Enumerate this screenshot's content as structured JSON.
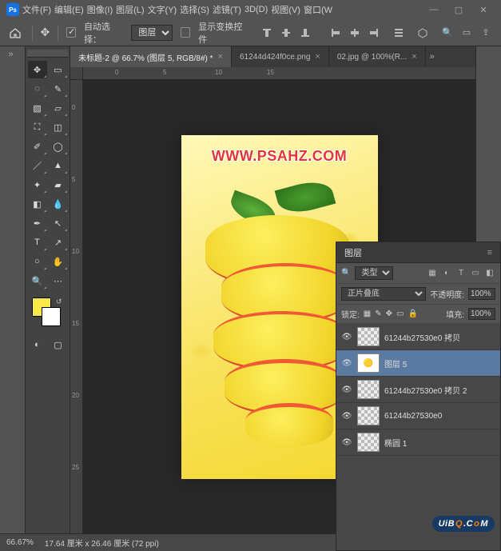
{
  "titlebar": {
    "logo": "Ps",
    "menus": [
      "文件(F)",
      "编辑(E)",
      "图像(I)",
      "图层(L)",
      "文字(Y)",
      "选择(S)",
      "滤镜(T)",
      "3D(D)",
      "视图(V)",
      "窗口(W"
    ]
  },
  "options": {
    "auto_select": "自动选择：",
    "layer": "图层",
    "show_transform": "显示变换控件"
  },
  "doctabs": [
    {
      "label": "未标题-2 @ 66.7% (图层 5, RGB/8#) *",
      "active": true
    },
    {
      "label": "61244d424f0ce.png",
      "active": false
    },
    {
      "label": "02.jpg @ 100%(R...",
      "active": false
    }
  ],
  "canvas": {
    "watermark": "WWW.PSAHZ.COM"
  },
  "layers_panel": {
    "title": "图层",
    "filter_label": "类型",
    "blend_mode": "正片叠底",
    "opacity_label": "不透明度:",
    "opacity_value": "100%",
    "lock_label": "锁定:",
    "fill_label": "填充:",
    "fill_value": "100%",
    "items": [
      {
        "name": "61244b27530e0 拷贝",
        "checker": true,
        "sel": false
      },
      {
        "name": "图层 5",
        "checker": false,
        "sel": true
      },
      {
        "name": "61244b27530e0 拷贝 2",
        "checker": true,
        "sel": false
      },
      {
        "name": "61244b27530e0",
        "checker": true,
        "sel": false
      },
      {
        "name": "椭圆 1",
        "checker": true,
        "sel": false
      }
    ]
  },
  "status": {
    "zoom": "66.67%",
    "info": "17.64 厘米 x 26.46 厘米 (72 ppi)"
  },
  "brand": {
    "t": "UiB",
    "o": "Q",
    "t2": ".C",
    "o2": "o",
    "t3": "M"
  }
}
